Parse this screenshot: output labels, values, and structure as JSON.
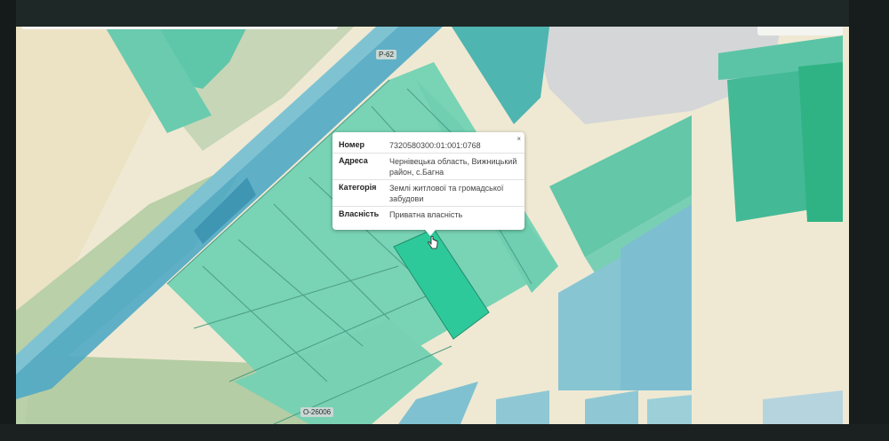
{
  "map": {
    "road_label_main": "Р-62",
    "road_label_local": "О-26006"
  },
  "popup": {
    "close_label": "×",
    "rows": [
      {
        "key": "Номер",
        "value": "7320580300:01:001:0768"
      },
      {
        "key": "Адреса",
        "value": "Чернівецька область, Вижницький район, с.Багна"
      },
      {
        "key": "Категорія",
        "value": "Землі житлової та громадської забудови"
      },
      {
        "key": "Власність",
        "value": "Приватна власність"
      }
    ]
  },
  "colors": {
    "background": "#efe9d3",
    "parcel_green": "#7fd6b9",
    "parcel_selected": "#2ec99a",
    "parcel_blue": "#86c7d3",
    "road_blue": "#4fb0c9",
    "forest_green": "#b7cfa8"
  }
}
